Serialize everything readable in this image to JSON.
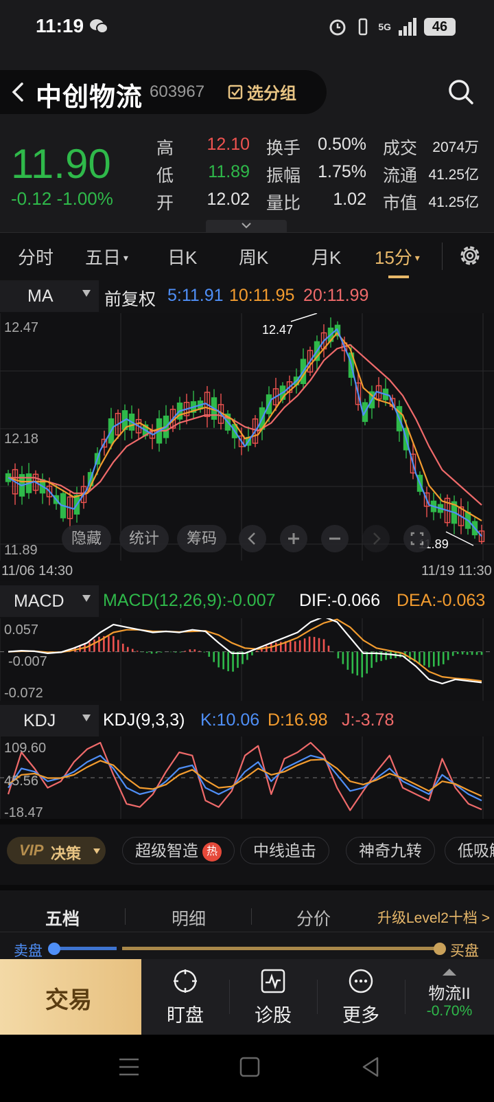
{
  "status": {
    "time": "11:19",
    "network": "5G",
    "battery": "46"
  },
  "header": {
    "name": "中创物流",
    "code": "603967",
    "group_label": "选分组"
  },
  "quote": {
    "price": "11.90",
    "change": "-0.12",
    "change_pct": "-1.00%",
    "stats": [
      {
        "label": "高",
        "value": "12.10",
        "color": "#ef5350"
      },
      {
        "label": "低",
        "value": "11.89",
        "color": "#2fb94a"
      },
      {
        "label": "开",
        "value": "12.02",
        "color": "#e6e6e6"
      },
      {
        "label": "换手",
        "value": "0.50%"
      },
      {
        "label": "振幅",
        "value": "1.75%"
      },
      {
        "label": "量比",
        "value": "1.02"
      },
      {
        "label": "成交",
        "value": "2074万"
      },
      {
        "label": "流通",
        "value": "41.25亿"
      },
      {
        "label": "市值",
        "value": "41.25亿"
      }
    ]
  },
  "tabs": [
    "分时",
    "五日",
    "日K",
    "周K",
    "月K",
    "15分"
  ],
  "active_tab": "15分",
  "ma_bar": {
    "selector": "MA",
    "adjust": "前复权",
    "ma5": "5:11.91",
    "ma10": "10:11.95",
    "ma20": "20:11.99"
  },
  "kline": {
    "y_high": "12.47",
    "y_mid": "12.18",
    "y_low": "11.89",
    "hi_label": "12.47",
    "lo_label": "11.89",
    "x_start": "11/06 14:30",
    "x_end": "11/19 11:30"
  },
  "chart_tools": {
    "hide": "隐藏",
    "stats": "统计",
    "chips": "筹码"
  },
  "macd_bar": {
    "selector": "MACD",
    "macd": "MACD(12,26,9):-0.007",
    "dif": "DIF:-0.066",
    "dea": "DEA:-0.063"
  },
  "macd": {
    "y_top": "0.057",
    "y_mid": "-0.007",
    "y_bot": "-0.072"
  },
  "kdj_bar": {
    "selector": "KDJ",
    "params": "KDJ(9,3,3)",
    "k": "K:10.06",
    "d": "D:16.98",
    "j": "J:-3.78"
  },
  "kdj": {
    "y_top": "109.60",
    "y_mid": "45.56",
    "y_bot": "-18.47"
  },
  "strategies": {
    "vip1": "VIP",
    "vip2": "决策",
    "chips": [
      "超级智造",
      "中线追击",
      "神奇九转",
      "低吸解"
    ],
    "hot": "热"
  },
  "book": {
    "tabs": [
      "五档",
      "明细",
      "分价"
    ],
    "upgrade": "升级Level2十档 >",
    "sell": "卖盘",
    "buy": "买盘"
  },
  "toolbar": {
    "trade": "交易",
    "watch": "盯盘",
    "diagnose": "诊股",
    "more": "更多",
    "sector": "物流II",
    "sector_pct": "-0.70%"
  },
  "chart_data": [
    {
      "type": "line",
      "title": "",
      "y_ticks": [
        12.47,
        12.18,
        11.89
      ],
      "x_range_labels": [
        "11/06 14:30",
        "11/19 11:30"
      ],
      "series": [
        {
          "name": "MA5",
          "values": [
            12.06,
            12.04,
            12.05,
            12.03,
            11.99,
            11.98,
            12.03,
            12.13,
            12.19,
            12.21,
            12.19,
            12.17,
            12.19,
            12.23,
            12.24,
            12.25,
            12.23,
            12.19,
            12.14,
            12.19,
            12.26,
            12.28,
            12.31,
            12.36,
            12.41,
            12.44,
            12.36,
            12.22,
            12.28,
            12.27,
            12.19,
            12.07,
            11.99,
            11.98,
            11.97,
            11.95,
            11.91
          ]
        },
        {
          "name": "MA10",
          "values": [
            12.06,
            12.05,
            12.05,
            12.05,
            12.03,
            12.01,
            12.02,
            12.09,
            12.15,
            12.19,
            12.2,
            12.18,
            12.19,
            12.22,
            12.23,
            12.24,
            12.23,
            12.21,
            12.16,
            12.17,
            12.22,
            12.27,
            12.3,
            12.35,
            12.39,
            12.43,
            12.39,
            12.29,
            12.26,
            12.25,
            12.22,
            12.13,
            12.04,
            12.0,
            11.99,
            11.97,
            11.95
          ]
        },
        {
          "name": "MA20",
          "values": [
            12.06,
            12.06,
            12.06,
            12.05,
            12.04,
            12.02,
            12.02,
            12.05,
            12.1,
            12.14,
            12.16,
            12.18,
            12.18,
            12.2,
            12.21,
            12.22,
            12.22,
            12.21,
            12.19,
            12.18,
            12.2,
            12.24,
            12.27,
            12.31,
            12.36,
            12.39,
            12.4,
            12.37,
            12.34,
            12.31,
            12.27,
            12.21,
            12.14,
            12.08,
            12.05,
            12.02,
            11.99
          ]
        }
      ]
    },
    {
      "type": "line",
      "title": "",
      "y_ticks": [
        0.057,
        -0.007,
        -0.072
      ],
      "series": [
        {
          "name": "DIF",
          "values": [
            -0.007,
            -0.005,
            -0.006,
            -0.01,
            -0.008,
            0.0,
            0.01,
            0.03,
            0.045,
            0.04,
            0.035,
            0.03,
            0.032,
            0.03,
            0.035,
            0.032,
            0.01,
            -0.01,
            -0.01,
            0.0,
            0.01,
            0.02,
            0.03,
            0.05,
            0.06,
            0.05,
            0.02,
            -0.01,
            -0.01,
            -0.012,
            -0.015,
            -0.035,
            -0.06,
            -0.068,
            -0.06,
            -0.063,
            -0.066
          ]
        },
        {
          "name": "DEA",
          "values": [
            -0.007,
            -0.006,
            -0.006,
            -0.008,
            -0.008,
            -0.004,
            0.002,
            0.015,
            0.03,
            0.035,
            0.035,
            0.032,
            0.032,
            0.031,
            0.032,
            0.033,
            0.025,
            0.01,
            0.0,
            -0.002,
            0.002,
            0.01,
            0.02,
            0.035,
            0.048,
            0.055,
            0.04,
            0.015,
            0.0,
            -0.005,
            -0.01,
            -0.025,
            -0.045,
            -0.055,
            -0.058,
            -0.06,
            -0.063
          ]
        }
      ]
    },
    {
      "type": "line",
      "title": "",
      "y_ticks": [
        109.6,
        45.56,
        -18.47
      ],
      "series": [
        {
          "name": "K",
          "values": [
            30,
            60,
            55,
            40,
            45,
            55,
            70,
            80,
            60,
            30,
            20,
            25,
            40,
            60,
            65,
            30,
            20,
            30,
            55,
            70,
            40,
            60,
            70,
            80,
            75,
            50,
            25,
            30,
            45,
            60,
            40,
            30,
            20,
            50,
            35,
            20,
            10.06
          ]
        },
        {
          "name": "D",
          "values": [
            35,
            50,
            52,
            45,
            45,
            50,
            62,
            72,
            65,
            45,
            30,
            28,
            35,
            50,
            58,
            42,
            30,
            32,
            45,
            60,
            50,
            55,
            65,
            73,
            74,
            60,
            40,
            35,
            42,
            52,
            45,
            35,
            25,
            40,
            36,
            26,
            16.98
          ]
        },
        {
          "name": "J",
          "values": [
            20,
            85,
            60,
            30,
            40,
            70,
            90,
            100,
            50,
            5,
            0,
            20,
            55,
            85,
            80,
            10,
            0,
            25,
            80,
            95,
            20,
            75,
            85,
            100,
            80,
            30,
            -5,
            25,
            55,
            80,
            30,
            20,
            10,
            75,
            30,
            5,
            -3.78
          ]
        }
      ]
    }
  ]
}
